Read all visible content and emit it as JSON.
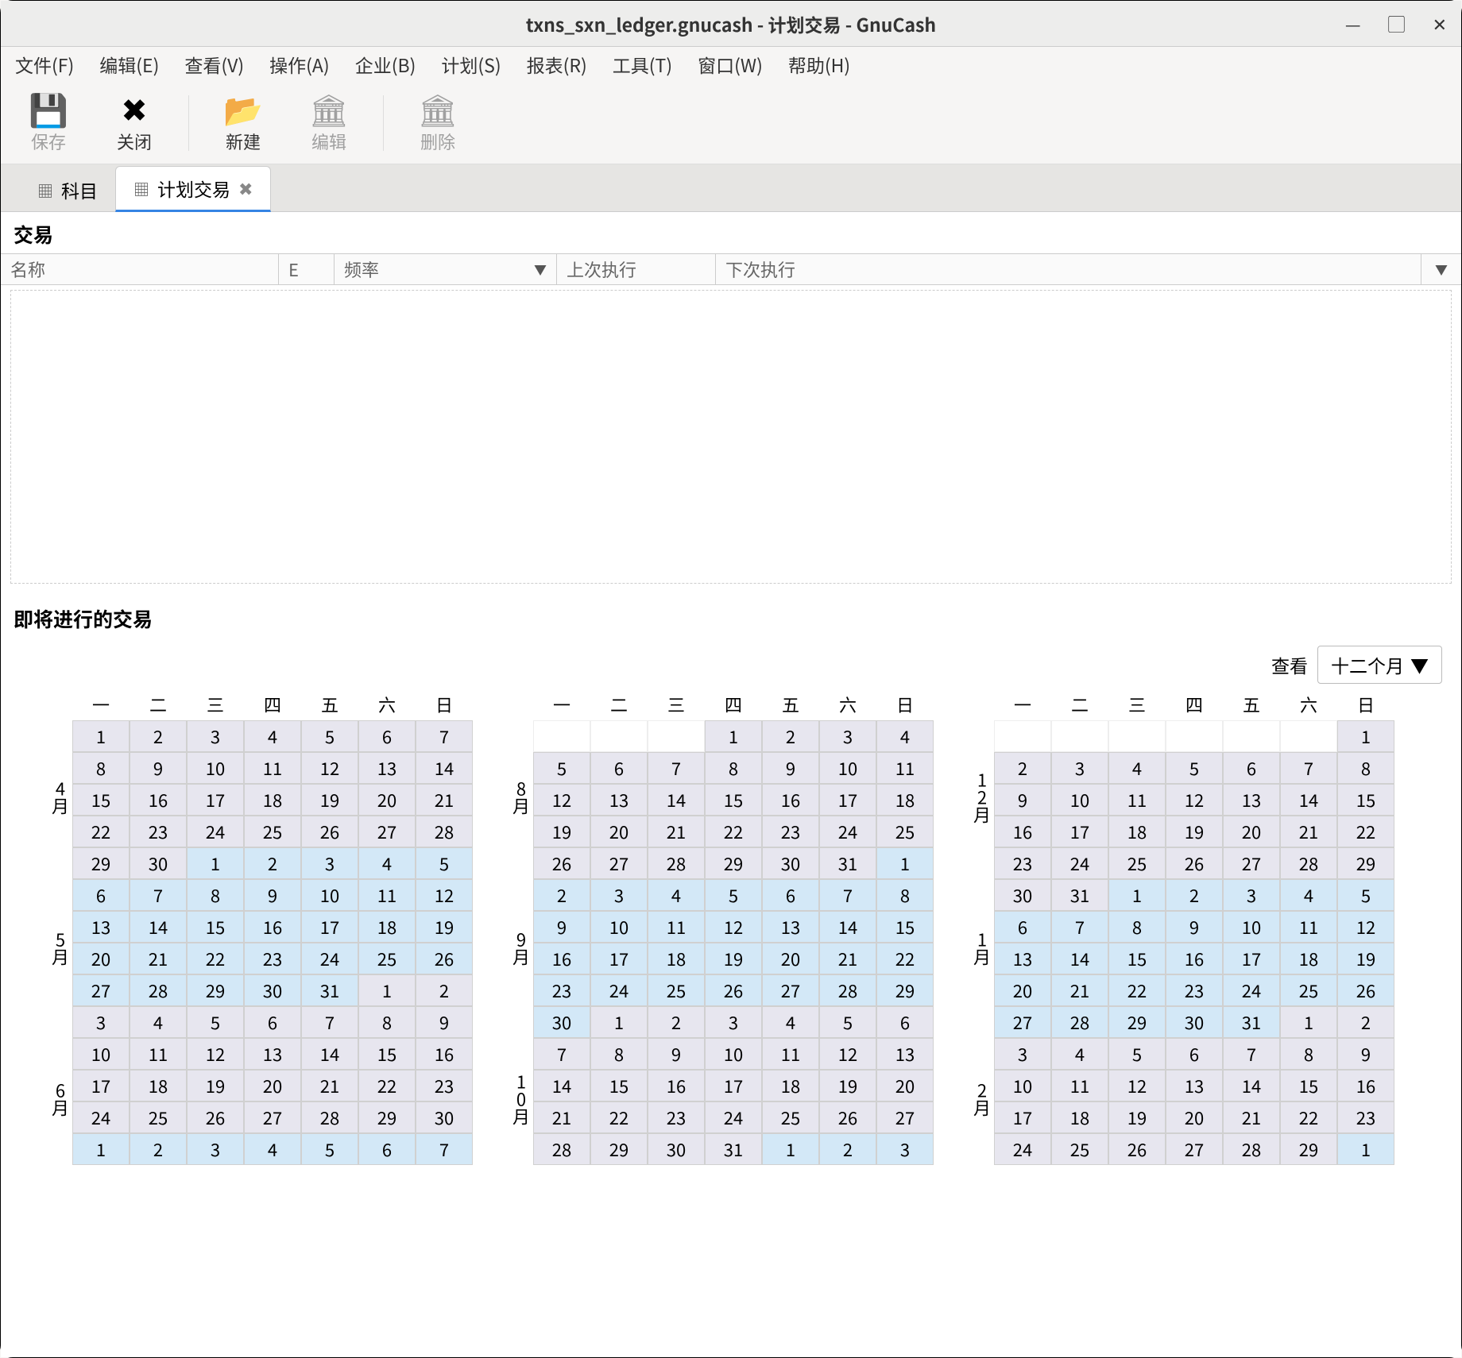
{
  "window": {
    "title": "txns_sxn_ledger.gnucash - 计划交易 - GnuCash"
  },
  "menu": {
    "file": "文件(F)",
    "edit": "编辑(E)",
    "view": "查看(V)",
    "actions": "操作(A)",
    "business": "企业(B)",
    "scheduled": "计划(S)",
    "reports": "报表(R)",
    "tools": "工具(T)",
    "windows": "窗口(W)",
    "help": "帮助(H)"
  },
  "toolbar": {
    "save": "保存",
    "close": "关闭",
    "new": "新建",
    "edit": "编辑",
    "delete": "删除"
  },
  "tabs": {
    "accounts": "科目",
    "scheduled": "计划交易"
  },
  "section": {
    "transactions": "交易",
    "upcoming": "即将进行的交易"
  },
  "columns": {
    "name": "名称",
    "e": "E",
    "freq": "频率",
    "last": "上次执行",
    "next": "下次执行"
  },
  "viewbar": {
    "label": "查看",
    "button": "十二个月"
  },
  "dow": [
    "一",
    "二",
    "三",
    "四",
    "五",
    "六",
    "日"
  ],
  "months": {
    "l1": [
      "4月",
      "5月",
      "6月"
    ],
    "l2": [
      "8月",
      "9月",
      "10月"
    ],
    "l3": [
      "12月",
      "1月",
      "2月"
    ]
  },
  "grids": {
    "g1": [
      [
        [
          "1",
          "m4"
        ],
        [
          "2",
          "m4"
        ],
        [
          "3",
          "m4"
        ],
        [
          "4",
          "m4"
        ],
        [
          "5",
          "m4"
        ],
        [
          "6",
          "m4"
        ],
        [
          "7",
          "m4"
        ]
      ],
      [
        [
          "8",
          "m4"
        ],
        [
          "9",
          "m4"
        ],
        [
          "10",
          "m4"
        ],
        [
          "11",
          "m4"
        ],
        [
          "12",
          "m4"
        ],
        [
          "13",
          "m4"
        ],
        [
          "14",
          "m4"
        ]
      ],
      [
        [
          "15",
          "m4"
        ],
        [
          "16",
          "m4"
        ],
        [
          "17",
          "m4"
        ],
        [
          "18",
          "m4"
        ],
        [
          "19",
          "m4"
        ],
        [
          "20",
          "m4"
        ],
        [
          "21",
          "m4"
        ]
      ],
      [
        [
          "22",
          "m4"
        ],
        [
          "23",
          "m4"
        ],
        [
          "24",
          "m4"
        ],
        [
          "25",
          "m4"
        ],
        [
          "26",
          "m4"
        ],
        [
          "27",
          "m4"
        ],
        [
          "28",
          "m4"
        ]
      ],
      [
        [
          "29",
          "m4"
        ],
        [
          "30",
          "m4"
        ],
        [
          "1",
          "m5"
        ],
        [
          "2",
          "m5"
        ],
        [
          "3",
          "m5"
        ],
        [
          "4",
          "m5"
        ],
        [
          "5",
          "m5"
        ]
      ],
      [
        [
          "6",
          "m5"
        ],
        [
          "7",
          "m5"
        ],
        [
          "8",
          "m5"
        ],
        [
          "9",
          "m5"
        ],
        [
          "10",
          "m5"
        ],
        [
          "11",
          "m5"
        ],
        [
          "12",
          "m5"
        ]
      ],
      [
        [
          "13",
          "m5"
        ],
        [
          "14",
          "m5"
        ],
        [
          "15",
          "m5"
        ],
        [
          "16",
          "m5"
        ],
        [
          "17",
          "m5"
        ],
        [
          "18",
          "m5"
        ],
        [
          "19",
          "m5"
        ]
      ],
      [
        [
          "20",
          "m5"
        ],
        [
          "21",
          "m5"
        ],
        [
          "22",
          "m5"
        ],
        [
          "23",
          "m5"
        ],
        [
          "24",
          "m5"
        ],
        [
          "25",
          "m5"
        ],
        [
          "26",
          "m5"
        ]
      ],
      [
        [
          "27",
          "m5"
        ],
        [
          "28",
          "m5"
        ],
        [
          "29",
          "m5"
        ],
        [
          "30",
          "m5"
        ],
        [
          "31",
          "m5"
        ],
        [
          "1",
          "m6"
        ],
        [
          "2",
          "m6"
        ]
      ],
      [
        [
          "3",
          "m6"
        ],
        [
          "4",
          "m6"
        ],
        [
          "5",
          "m6"
        ],
        [
          "6",
          "m6"
        ],
        [
          "7",
          "m6"
        ],
        [
          "8",
          "m6"
        ],
        [
          "9",
          "m6"
        ]
      ],
      [
        [
          "10",
          "m6"
        ],
        [
          "11",
          "m6"
        ],
        [
          "12",
          "m6"
        ],
        [
          "13",
          "m6"
        ],
        [
          "14",
          "m6"
        ],
        [
          "15",
          "m6"
        ],
        [
          "16",
          "m6"
        ]
      ],
      [
        [
          "17",
          "m6"
        ],
        [
          "18",
          "m6"
        ],
        [
          "19",
          "m6"
        ],
        [
          "20",
          "m6"
        ],
        [
          "21",
          "m6"
        ],
        [
          "22",
          "m6"
        ],
        [
          "23",
          "m6"
        ]
      ],
      [
        [
          "24",
          "m6"
        ],
        [
          "25",
          "m6"
        ],
        [
          "26",
          "m6"
        ],
        [
          "27",
          "m6"
        ],
        [
          "28",
          "m6"
        ],
        [
          "29",
          "m6"
        ],
        [
          "30",
          "m6"
        ]
      ],
      [
        [
          "1",
          "m7"
        ],
        [
          "2",
          "m7"
        ],
        [
          "3",
          "m7"
        ],
        [
          "4",
          "m7"
        ],
        [
          "5",
          "m7"
        ],
        [
          "6",
          "m7"
        ],
        [
          "7",
          "m7"
        ]
      ]
    ],
    "g2": [
      [
        [
          "",
          "blank"
        ],
        [
          "",
          "blank"
        ],
        [
          "",
          "blank"
        ],
        [
          "1",
          "m8"
        ],
        [
          "2",
          "m8"
        ],
        [
          "3",
          "m8"
        ],
        [
          "4",
          "m8"
        ]
      ],
      [
        [
          "5",
          "m8"
        ],
        [
          "6",
          "m8"
        ],
        [
          "7",
          "m8"
        ],
        [
          "8",
          "m8"
        ],
        [
          "9",
          "m8"
        ],
        [
          "10",
          "m8"
        ],
        [
          "11",
          "m8"
        ]
      ],
      [
        [
          "12",
          "m8"
        ],
        [
          "13",
          "m8"
        ],
        [
          "14",
          "m8"
        ],
        [
          "15",
          "m8"
        ],
        [
          "16",
          "m8"
        ],
        [
          "17",
          "m8"
        ],
        [
          "18",
          "m8"
        ]
      ],
      [
        [
          "19",
          "m8"
        ],
        [
          "20",
          "m8"
        ],
        [
          "21",
          "m8"
        ],
        [
          "22",
          "m8"
        ],
        [
          "23",
          "m8"
        ],
        [
          "24",
          "m8"
        ],
        [
          "25",
          "m8"
        ]
      ],
      [
        [
          "26",
          "m8"
        ],
        [
          "27",
          "m8"
        ],
        [
          "28",
          "m8"
        ],
        [
          "29",
          "m8"
        ],
        [
          "30",
          "m8"
        ],
        [
          "31",
          "m8"
        ],
        [
          "1",
          "m9"
        ]
      ],
      [
        [
          "2",
          "m9"
        ],
        [
          "3",
          "m9"
        ],
        [
          "4",
          "m9"
        ],
        [
          "5",
          "m9"
        ],
        [
          "6",
          "m9"
        ],
        [
          "7",
          "m9"
        ],
        [
          "8",
          "m9"
        ]
      ],
      [
        [
          "9",
          "m9"
        ],
        [
          "10",
          "m9"
        ],
        [
          "11",
          "m9"
        ],
        [
          "12",
          "m9"
        ],
        [
          "13",
          "m9"
        ],
        [
          "14",
          "m9"
        ],
        [
          "15",
          "m9"
        ]
      ],
      [
        [
          "16",
          "m9"
        ],
        [
          "17",
          "m9"
        ],
        [
          "18",
          "m9"
        ],
        [
          "19",
          "m9"
        ],
        [
          "20",
          "m9"
        ],
        [
          "21",
          "m9"
        ],
        [
          "22",
          "m9"
        ]
      ],
      [
        [
          "23",
          "m9"
        ],
        [
          "24",
          "m9"
        ],
        [
          "25",
          "m9"
        ],
        [
          "26",
          "m9"
        ],
        [
          "27",
          "m9"
        ],
        [
          "28",
          "m9"
        ],
        [
          "29",
          "m9"
        ]
      ],
      [
        [
          "30",
          "m9"
        ],
        [
          "1",
          "m10"
        ],
        [
          "2",
          "m10"
        ],
        [
          "3",
          "m10"
        ],
        [
          "4",
          "m10"
        ],
        [
          "5",
          "m10"
        ],
        [
          "6",
          "m10"
        ]
      ],
      [
        [
          "7",
          "m10"
        ],
        [
          "8",
          "m10"
        ],
        [
          "9",
          "m10"
        ],
        [
          "10",
          "m10"
        ],
        [
          "11",
          "m10"
        ],
        [
          "12",
          "m10"
        ],
        [
          "13",
          "m10"
        ]
      ],
      [
        [
          "14",
          "m10"
        ],
        [
          "15",
          "m10"
        ],
        [
          "16",
          "m10"
        ],
        [
          "17",
          "m10"
        ],
        [
          "18",
          "m10"
        ],
        [
          "19",
          "m10"
        ],
        [
          "20",
          "m10"
        ]
      ],
      [
        [
          "21",
          "m10"
        ],
        [
          "22",
          "m10"
        ],
        [
          "23",
          "m10"
        ],
        [
          "24",
          "m10"
        ],
        [
          "25",
          "m10"
        ],
        [
          "26",
          "m10"
        ],
        [
          "27",
          "m10"
        ]
      ],
      [
        [
          "28",
          "m10"
        ],
        [
          "29",
          "m10"
        ],
        [
          "30",
          "m10"
        ],
        [
          "31",
          "m10"
        ],
        [
          "1",
          "m11"
        ],
        [
          "2",
          "m11"
        ],
        [
          "3",
          "m11"
        ]
      ]
    ],
    "g3": [
      [
        [
          "",
          "blank"
        ],
        [
          "",
          "blank"
        ],
        [
          "",
          "blank"
        ],
        [
          "",
          "blank"
        ],
        [
          "",
          "blank"
        ],
        [
          "",
          "blank"
        ],
        [
          "1",
          "m12"
        ]
      ],
      [
        [
          "2",
          "m12"
        ],
        [
          "3",
          "m12"
        ],
        [
          "4",
          "m12"
        ],
        [
          "5",
          "m12"
        ],
        [
          "6",
          "m12"
        ],
        [
          "7",
          "m12"
        ],
        [
          "8",
          "m12"
        ]
      ],
      [
        [
          "9",
          "m12"
        ],
        [
          "10",
          "m12"
        ],
        [
          "11",
          "m12"
        ],
        [
          "12",
          "m12"
        ],
        [
          "13",
          "m12"
        ],
        [
          "14",
          "m12"
        ],
        [
          "15",
          "m12"
        ]
      ],
      [
        [
          "16",
          "m12"
        ],
        [
          "17",
          "m12"
        ],
        [
          "18",
          "m12"
        ],
        [
          "19",
          "m12"
        ],
        [
          "20",
          "m12"
        ],
        [
          "21",
          "m12"
        ],
        [
          "22",
          "m12"
        ]
      ],
      [
        [
          "23",
          "m12"
        ],
        [
          "24",
          "m12"
        ],
        [
          "25",
          "m12"
        ],
        [
          "26",
          "m12"
        ],
        [
          "27",
          "m12"
        ],
        [
          "28",
          "m12"
        ],
        [
          "29",
          "m12"
        ]
      ],
      [
        [
          "30",
          "m12"
        ],
        [
          "31",
          "m12"
        ],
        [
          "1",
          "m1"
        ],
        [
          "2",
          "m1"
        ],
        [
          "3",
          "m1"
        ],
        [
          "4",
          "m1"
        ],
        [
          "5",
          "m1"
        ]
      ],
      [
        [
          "6",
          "m1"
        ],
        [
          "7",
          "m1"
        ],
        [
          "8",
          "m1"
        ],
        [
          "9",
          "m1"
        ],
        [
          "10",
          "m1"
        ],
        [
          "11",
          "m1"
        ],
        [
          "12",
          "m1"
        ]
      ],
      [
        [
          "13",
          "m1"
        ],
        [
          "14",
          "m1"
        ],
        [
          "15",
          "m1"
        ],
        [
          "16",
          "m1"
        ],
        [
          "17",
          "m1"
        ],
        [
          "18",
          "m1"
        ],
        [
          "19",
          "m1"
        ]
      ],
      [
        [
          "20",
          "m1"
        ],
        [
          "21",
          "m1"
        ],
        [
          "22",
          "m1"
        ],
        [
          "23",
          "m1"
        ],
        [
          "24",
          "m1"
        ],
        [
          "25",
          "m1"
        ],
        [
          "26",
          "m1"
        ]
      ],
      [
        [
          "27",
          "m1"
        ],
        [
          "28",
          "m1"
        ],
        [
          "29",
          "m1"
        ],
        [
          "30",
          "m1"
        ],
        [
          "31",
          "m1"
        ],
        [
          "1",
          "m2"
        ],
        [
          "2",
          "m2"
        ]
      ],
      [
        [
          "3",
          "m2"
        ],
        [
          "4",
          "m2"
        ],
        [
          "5",
          "m2"
        ],
        [
          "6",
          "m2"
        ],
        [
          "7",
          "m2"
        ],
        [
          "8",
          "m2"
        ],
        [
          "9",
          "m2"
        ]
      ],
      [
        [
          "10",
          "m2"
        ],
        [
          "11",
          "m2"
        ],
        [
          "12",
          "m2"
        ],
        [
          "13",
          "m2"
        ],
        [
          "14",
          "m2"
        ],
        [
          "15",
          "m2"
        ],
        [
          "16",
          "m2"
        ]
      ],
      [
        [
          "17",
          "m2"
        ],
        [
          "18",
          "m2"
        ],
        [
          "19",
          "m2"
        ],
        [
          "20",
          "m2"
        ],
        [
          "21",
          "m2"
        ],
        [
          "22",
          "m2"
        ],
        [
          "23",
          "m2"
        ]
      ],
      [
        [
          "24",
          "m2"
        ],
        [
          "25",
          "m2"
        ],
        [
          "26",
          "m2"
        ],
        [
          "27",
          "m2"
        ],
        [
          "28",
          "m2"
        ],
        [
          "29",
          "m2"
        ],
        [
          "1",
          "m3"
        ]
      ]
    ]
  }
}
